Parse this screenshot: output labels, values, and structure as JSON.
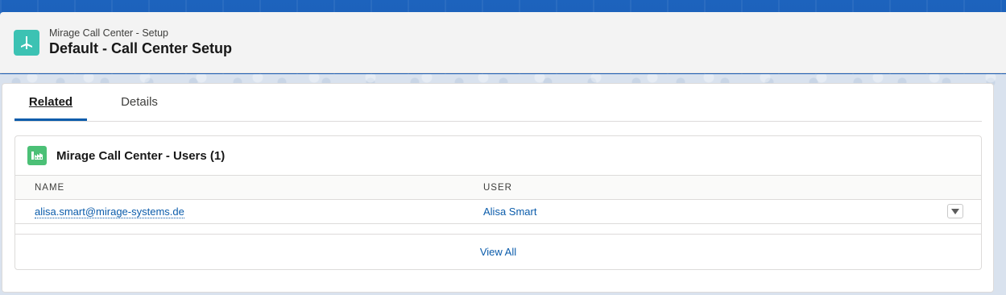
{
  "header": {
    "subtitle": "Mirage Call Center - Setup",
    "title": "Default - Call Center Setup",
    "icon": "call-center-icon"
  },
  "tabs": [
    {
      "label": "Related",
      "active": true
    },
    {
      "label": "Details",
      "active": false
    }
  ],
  "related_list": {
    "title": "Mirage Call Center - Users (1)",
    "icon": "users-list-icon",
    "columns": [
      "NAME",
      "USER"
    ],
    "rows": [
      {
        "name": "alisa.smart@mirage-systems.de",
        "user": "Alisa Smart"
      }
    ],
    "view_all_label": "View All"
  },
  "colors": {
    "accent": "#0b5cab",
    "app_icon": "#3cc2b3",
    "list_icon": "#4bc076",
    "band": "#1b5fb8"
  }
}
